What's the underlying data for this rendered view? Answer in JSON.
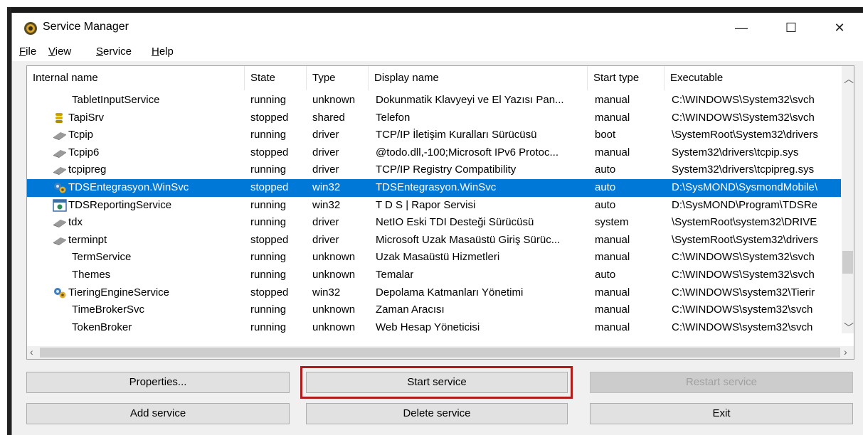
{
  "window": {
    "title": "Service Manager",
    "controls": {
      "minimize": "—",
      "maximize": "☐",
      "close": "✕"
    }
  },
  "menu": [
    {
      "label": "File",
      "accel": "F",
      "rest": "ile"
    },
    {
      "label": "View",
      "accel": "V",
      "rest": "iew"
    },
    {
      "label": "Service",
      "accel": "S",
      "rest": "ervice"
    },
    {
      "label": "Help",
      "accel": "H",
      "rest": "elp"
    }
  ],
  "columns": [
    "Internal name",
    "State",
    "Type",
    "Display name",
    "Start type",
    "Executable"
  ],
  "rows": [
    {
      "icon": "none",
      "name": "TabletInputService",
      "state": "running",
      "type": "unknown",
      "display": "Dokunmatik Klavyeyi ve El Yazısı Pan...",
      "start": "manual",
      "exe": "C:\\WINDOWS\\System32\\svch",
      "selected": false
    },
    {
      "icon": "shared-icon",
      "name": "TapiSrv",
      "state": "stopped",
      "type": "shared",
      "display": "Telefon",
      "start": "manual",
      "exe": "C:\\WINDOWS\\System32\\svch",
      "selected": false
    },
    {
      "icon": "driver-icon",
      "name": "Tcpip",
      "state": "running",
      "type": "driver",
      "display": "TCP/IP İletişim Kuralları Sürücüsü",
      "start": "boot",
      "exe": "\\SystemRoot\\System32\\drivers",
      "selected": false
    },
    {
      "icon": "driver-icon",
      "name": "Tcpip6",
      "state": "stopped",
      "type": "driver",
      "display": "@todo.dll,-100;Microsoft IPv6 Protoc...",
      "start": "manual",
      "exe": "System32\\drivers\\tcpip.sys",
      "selected": false
    },
    {
      "icon": "driver-icon",
      "name": "tcpipreg",
      "state": "running",
      "type": "driver",
      "display": "TCP/IP Registry Compatibility",
      "start": "auto",
      "exe": "System32\\drivers\\tcpipreg.sys",
      "selected": false
    },
    {
      "icon": "win32-icon",
      "name": "TDSEntegrasyon.WinSvc",
      "state": "stopped",
      "type": "win32",
      "display": "TDSEntegrasyon.WinSvc",
      "start": "auto",
      "exe": "D:\\SysMOND\\SysmondMobile\\",
      "selected": true
    },
    {
      "icon": "app-window-icon",
      "name": "TDSReportingService",
      "state": "running",
      "type": "win32",
      "display": "T D S | Rapor Servisi",
      "start": "auto",
      "exe": "D:\\SysMOND\\Program\\TDSRe",
      "selected": false
    },
    {
      "icon": "driver-icon",
      "name": "tdx",
      "state": "running",
      "type": "driver",
      "display": "NetIO Eski TDI Desteği Sürücüsü",
      "start": "system",
      "exe": "\\SystemRoot\\system32\\DRIVE",
      "selected": false
    },
    {
      "icon": "driver-icon",
      "name": "terminpt",
      "state": "stopped",
      "type": "driver",
      "display": "Microsoft Uzak Masaüstü Giriş Sürüc...",
      "start": "manual",
      "exe": "\\SystemRoot\\System32\\drivers",
      "selected": false
    },
    {
      "icon": "none",
      "name": "TermService",
      "state": "running",
      "type": "unknown",
      "display": "Uzak Masaüstü Hizmetleri",
      "start": "manual",
      "exe": "C:\\WINDOWS\\System32\\svch",
      "selected": false
    },
    {
      "icon": "none",
      "name": "Themes",
      "state": "running",
      "type": "unknown",
      "display": "Temalar",
      "start": "auto",
      "exe": "C:\\WINDOWS\\System32\\svch",
      "selected": false
    },
    {
      "icon": "win32-icon",
      "name": "TieringEngineService",
      "state": "stopped",
      "type": "win32",
      "display": "Depolama Katmanları Yönetimi",
      "start": "manual",
      "exe": "C:\\WINDOWS\\system32\\Tierir",
      "selected": false
    },
    {
      "icon": "none",
      "name": "TimeBrokerSvc",
      "state": "running",
      "type": "unknown",
      "display": "Zaman Aracısı",
      "start": "manual",
      "exe": "C:\\WINDOWS\\system32\\svch",
      "selected": false
    },
    {
      "icon": "none",
      "name": "TokenBroker",
      "state": "running",
      "type": "unknown",
      "display": "Web Hesap Yöneticisi",
      "start": "manual",
      "exe": "C:\\WINDOWS\\system32\\svch",
      "selected": false
    }
  ],
  "buttons": {
    "properties": "Properties...",
    "start": "Start service",
    "restart": "Restart service",
    "add": "Add service",
    "delete": "Delete service",
    "exit": "Exit"
  },
  "colors": {
    "selection": "#0078d7",
    "highlight_box": "#b01c1c"
  }
}
